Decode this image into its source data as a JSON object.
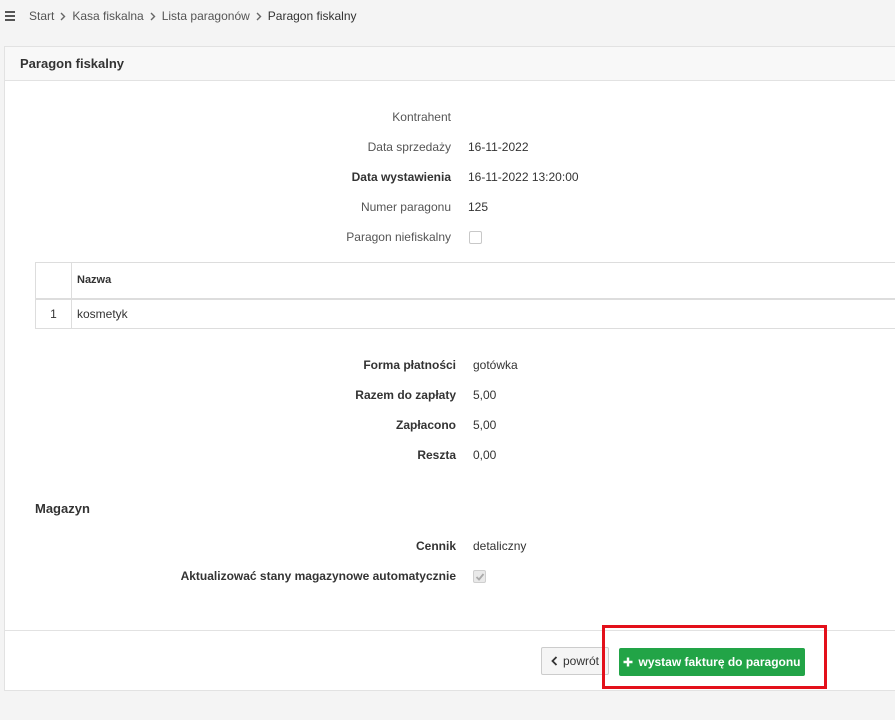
{
  "breadcrumb": {
    "items": [
      "Start",
      "Kasa fiskalna",
      "Lista paragonów",
      "Paragon fiskalny"
    ]
  },
  "panel": {
    "title": "Paragon fiskalny"
  },
  "form": {
    "kontrahent_label": "Kontrahent",
    "kontrahent_value": "",
    "data_sprzedazy_label": "Data sprzedaży",
    "data_sprzedazy_value": "16-11-2022",
    "data_wystawienia_label": "Data wystawienia",
    "data_wystawienia_value": "16-11-2022 13:20:00",
    "numer_paragonu_label": "Numer paragonu",
    "numer_paragonu_value": "125",
    "niefiskalny_label": "Paragon niefiskalny",
    "niefiskalny_checked": false
  },
  "items_table": {
    "headers": [
      "",
      "Nazwa"
    ],
    "rows": [
      {
        "num": "1",
        "nazwa": "kosmetyk"
      }
    ]
  },
  "payment": {
    "forma_label": "Forma płatności",
    "forma_value": "gotówka",
    "razem_label": "Razem do zapłaty",
    "razem_value": "5,00",
    "zaplacono_label": "Zapłacono",
    "zaplacono_value": "5,00",
    "reszta_label": "Reszta",
    "reszta_value": "0,00"
  },
  "magazyn": {
    "title": "Magazyn",
    "cennik_label": "Cennik",
    "cennik_value": "detaliczny",
    "aktualizowac_label": "Aktualizować stany magazynowe automatycznie",
    "aktualizowac_checked": true
  },
  "buttons": {
    "back_label": "powrót",
    "invoice_label": "wystaw fakturę do paragonu"
  },
  "colors": {
    "accent_green": "#22a447",
    "highlight_red": "#e3101a"
  }
}
